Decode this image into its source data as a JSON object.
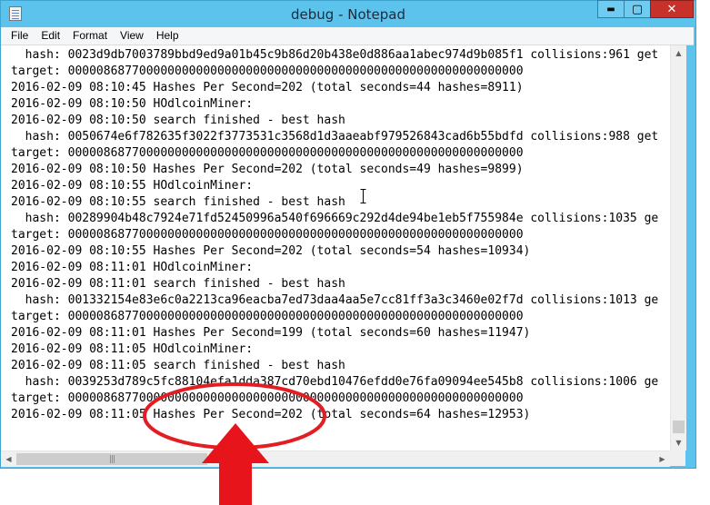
{
  "window": {
    "title": "debug - Notepad",
    "minimize_glyph": "▬",
    "maximize_glyph": "▢",
    "close_glyph": "✕",
    "app_icon": "notepad-icon"
  },
  "menu": {
    "items": [
      "File",
      "Edit",
      "Format",
      "View",
      "Help"
    ]
  },
  "editor": {
    "lines": [
      "  hash: 0023d9db7003789bbd9ed9a01b45c9b86d20b438e0d886aa1abec974d9b085f1 collisions:961 get",
      "target: 0000086877000000000000000000000000000000000000000000000000000000",
      "2016-02-09 08:10:45 Hashes Per Second=202 (total seconds=44 hashes=8911)",
      "2016-02-09 08:10:50 HOdlcoinMiner:",
      "2016-02-09 08:10:50 search finished - best hash",
      "  hash: 0050674e6f782635f3022f3773531c3568d1d3aaeabf979526843cad6b55bdfd collisions:988 get",
      "target: 0000086877000000000000000000000000000000000000000000000000000000",
      "2016-02-09 08:10:50 Hashes Per Second=202 (total seconds=49 hashes=9899)",
      "2016-02-09 08:10:55 HOdlcoinMiner:",
      "2016-02-09 08:10:55 search finished - best hash",
      "  hash: 00289904b48c7924e71fd52450996a540f696669c292d4de94be1eb5f755984e collisions:1035 ge",
      "target: 0000086877000000000000000000000000000000000000000000000000000000",
      "2016-02-09 08:10:55 Hashes Per Second=202 (total seconds=54 hashes=10934)",
      "2016-02-09 08:11:01 HOdlcoinMiner:",
      "2016-02-09 08:11:01 search finished - best hash",
      "  hash: 001332154e83e6c0a2213ca96eacba7ed73daa4aa5e7cc81ff3a3c3460e02f7d collisions:1013 ge",
      "target: 0000086877000000000000000000000000000000000000000000000000000000",
      "2016-02-09 08:11:01 Hashes Per Second=199 (total seconds=60 hashes=11947)",
      "2016-02-09 08:11:05 HOdlcoinMiner:",
      "2016-02-09 08:11:05 search finished - best hash",
      "  hash: 0039253d789c5fc88104efa1dda387cd70ebd10476efdd0e76fa09094ee545b8 collisions:1006 ge",
      "target: 0000086877000000000000000000000000000000000000000000000000000000",
      "2016-02-09 08:11:05 Hashes Per Second=202 (total seconds=64 hashes=12953)"
    ]
  },
  "scrollbars": {
    "up_arrow": "▲",
    "down_arrow": "▼",
    "left_arrow": "◀",
    "right_arrow": "▶",
    "grip": "|||",
    "vertical_position": 0.95
  },
  "annotation": {
    "ellipse_color": "#e21d24",
    "arrow_color": "#e8141c"
  }
}
